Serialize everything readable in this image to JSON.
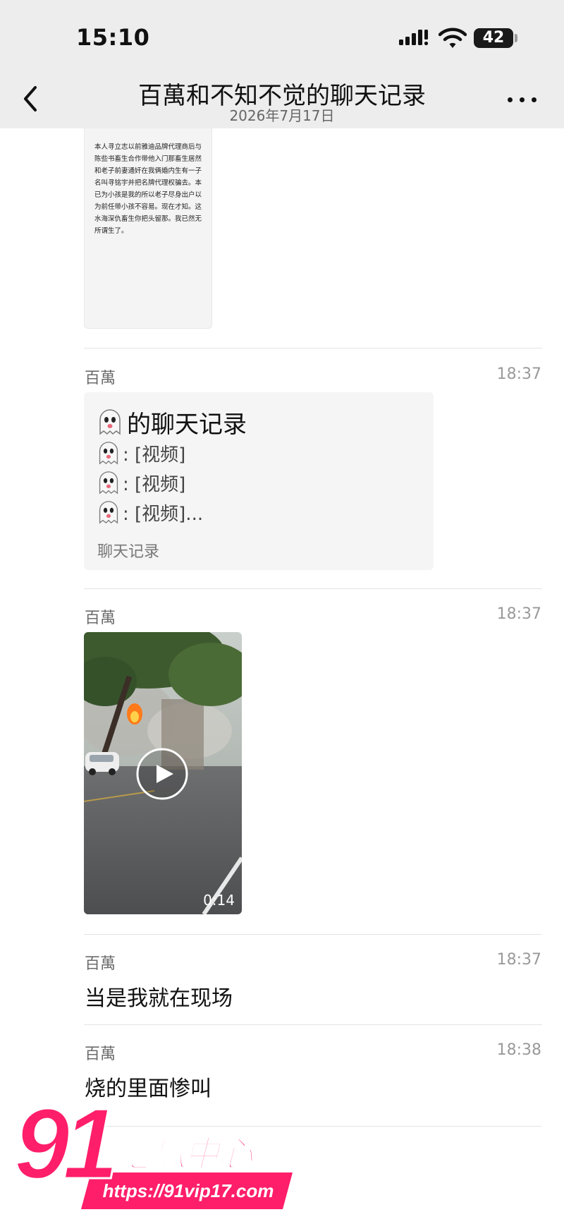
{
  "status_bar": {
    "time": "15:10",
    "battery": "42"
  },
  "header": {
    "title": "百萬和不知不觉的聊天记录",
    "date": "2026年7月17日"
  },
  "document_image": {
    "text": "本人寻立志以前雅迪品牌代理商后与陈些书畜生合作带他入门那畜生居然和老子前妻通奸在我俩婚内生有一子名叫寻铭宇并把名牌代理权骗去。本已为小孩是我的所以老子尽身出户以为前任带小孩不容易。现在才知。这水海深仇畜生你把头留那。我已然无所谓生了。"
  },
  "messages": [
    {
      "sender": "百萬",
      "time": "18:37",
      "type": "chat_record",
      "title": "的聊天记录",
      "lines": [
        ": [视频]",
        ": [视频]",
        ": [视频]..."
      ],
      "footer": "聊天记录"
    },
    {
      "sender": "百萬",
      "time": "18:37",
      "type": "video",
      "duration": "0:14"
    },
    {
      "sender": "百萬",
      "time": "18:37",
      "type": "text",
      "text": "当是我就在现场"
    },
    {
      "sender": "百萬",
      "time": "18:38",
      "type": "text",
      "text": "烧的里面惨叫"
    }
  ],
  "watermark": {
    "number": "91",
    "title": "吃瓜中心",
    "url": "https://91vip17.com"
  },
  "icons": {
    "back": "chevron-left-icon",
    "more": "more-dots-icon",
    "ghost": "ghost-emoji-icon",
    "play": "play-icon"
  },
  "colors": {
    "header_bg": "#ededed",
    "card_bg": "#f5f5f5",
    "watermark_pink": "#ff1e6a"
  }
}
